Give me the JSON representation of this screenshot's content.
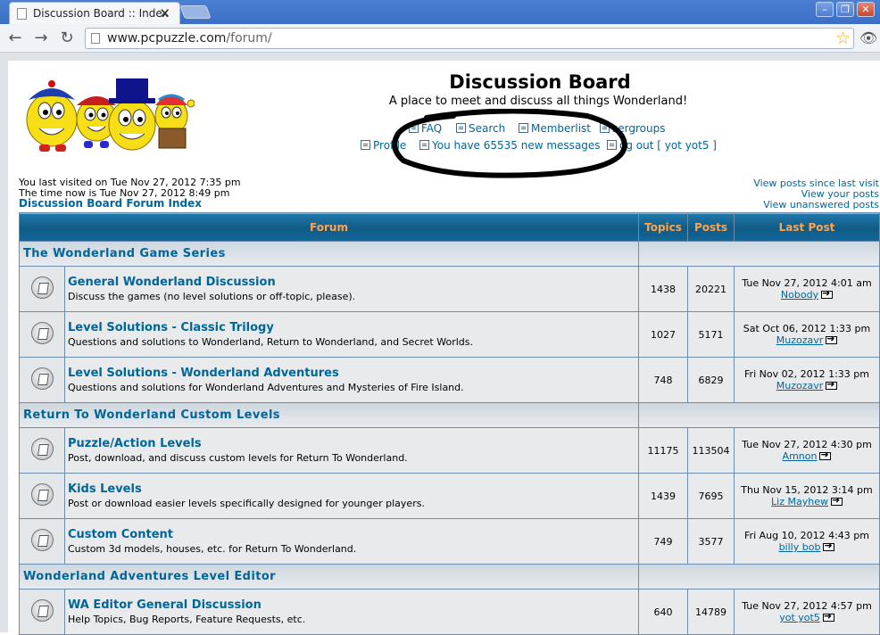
{
  "browser": {
    "tab_title": "Discussion Board :: Index",
    "tab_close": "✕",
    "url_host": "www.pcpuzzle.com",
    "url_path": "/forum/",
    "back": "←",
    "forward": "→",
    "reload": "↻",
    "star": "☆",
    "minimize": "–",
    "maximize": "❐",
    "close": "✕"
  },
  "header": {
    "title": "Discussion Board",
    "description": "A place to meet and discuss all things Wonderland!",
    "menu": {
      "faq": "FAQ",
      "search": "Search",
      "memberlist": "Memberlist",
      "usergroups": "sergroups",
      "profile": "Profile",
      "messages": "You have 65535 new messages",
      "logout": "og out [ yot yot5 ]"
    }
  },
  "info": {
    "last_visited": "You last visited on Tue Nov 27, 2012 7:35 pm",
    "time_now": "The time now is Tue Nov 27, 2012 8:49 pm",
    "index_link": "Discussion Board Forum Index",
    "posts_since": "View posts since last visit",
    "your_posts": "View your posts",
    "unanswered": "View unanswered posts"
  },
  "table": {
    "headers": {
      "forum": "Forum",
      "topics": "Topics",
      "posts": "Posts",
      "last_post": "Last Post"
    },
    "categories": [
      {
        "title": "The Wonderland Game Series",
        "forums": [
          {
            "name": "General Wonderland Discussion",
            "desc": "Discuss the games (no level solutions or off-topic, please).",
            "topics": "1438",
            "posts": "20221",
            "last_date": "Tue Nov 27, 2012 4:01 am",
            "last_user": "Nobody"
          },
          {
            "name": "Level Solutions - Classic Trilogy",
            "desc": "Questions and solutions to Wonderland, Return to Wonderland, and Secret Worlds.",
            "topics": "1027",
            "posts": "5171",
            "last_date": "Sat Oct 06, 2012 1:33 pm",
            "last_user": "Muzozavr"
          },
          {
            "name": "Level Solutions - Wonderland Adventures",
            "desc": "Questions and solutions for Wonderland Adventures and Mysteries of Fire Island.",
            "topics": "748",
            "posts": "6829",
            "last_date": "Fri Nov 02, 2012 1:33 pm",
            "last_user": "Muzozavr"
          }
        ]
      },
      {
        "title": "Return To Wonderland Custom Levels",
        "forums": [
          {
            "name": "Puzzle/Action Levels",
            "desc": "Post, download, and discuss custom levels for Return To Wonderland.",
            "topics": "11175",
            "posts": "113504",
            "last_date": "Tue Nov 27, 2012 4:30 pm",
            "last_user": "Amnon"
          },
          {
            "name": "Kids Levels",
            "desc": "Post or download easier levels specifically designed for younger players.",
            "topics": "1439",
            "posts": "7695",
            "last_date": "Thu Nov 15, 2012 3:14 pm",
            "last_user": "Liz Mayhew"
          },
          {
            "name": "Custom Content",
            "desc": "Custom 3d models, houses, etc. for Return To Wonderland.",
            "topics": "749",
            "posts": "3577",
            "last_date": "Fri Aug 10, 2012 4:43 pm",
            "last_user": "billy bob"
          }
        ]
      },
      {
        "title": "Wonderland Adventures Level Editor",
        "forums": [
          {
            "name": "WA Editor General Discussion",
            "desc": "Help Topics, Bug Reports, Feature Requests, etc.",
            "topics": "640",
            "posts": "14789",
            "last_date": "Tue Nov 27, 2012 4:57 pm",
            "last_user": "yot yot5"
          }
        ]
      }
    ]
  }
}
